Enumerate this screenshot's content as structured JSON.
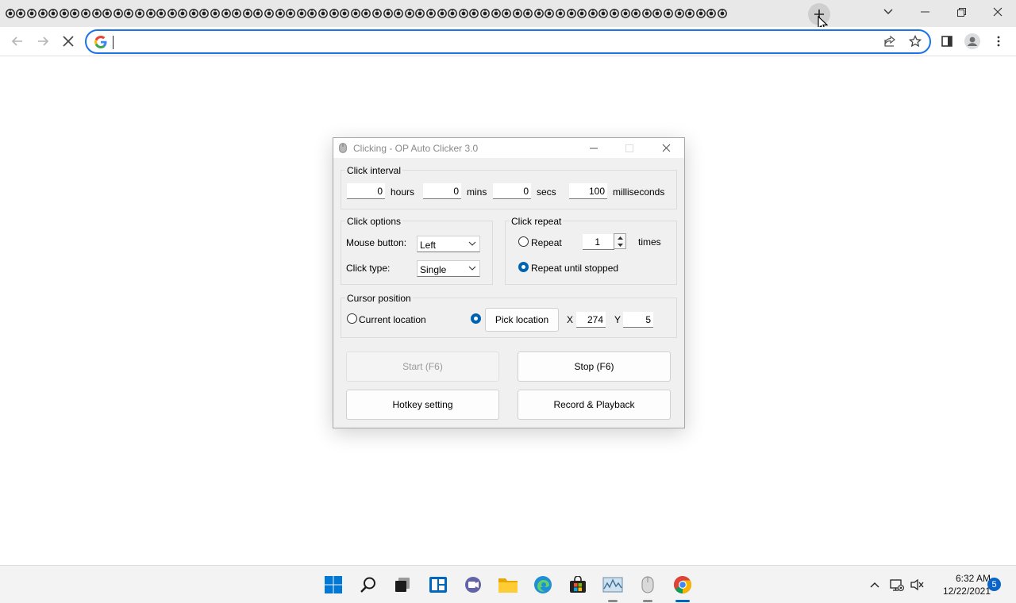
{
  "browser": {
    "tab_count": 67,
    "omnibox": {
      "value": "",
      "placeholder": ""
    }
  },
  "dialog": {
    "title": "Clicking - OP Auto Clicker 3.0",
    "click_interval": {
      "title": "Click interval",
      "hours": {
        "value": "0",
        "unit": "hours"
      },
      "mins": {
        "value": "0",
        "unit": "mins"
      },
      "secs": {
        "value": "0",
        "unit": "secs"
      },
      "ms": {
        "value": "100",
        "unit": "milliseconds"
      }
    },
    "click_options": {
      "title": "Click options",
      "mouse_button_label": "Mouse button:",
      "mouse_button_value": "Left",
      "click_type_label": "Click type:",
      "click_type_value": "Single"
    },
    "click_repeat": {
      "title": "Click repeat",
      "repeat_label": "Repeat",
      "repeat_value": "1",
      "times_label": "times",
      "until_stopped_label": "Repeat until stopped",
      "selected": "until_stopped"
    },
    "cursor_position": {
      "title": "Cursor position",
      "current_location_label": "Current location",
      "pick_location_label": "Pick location",
      "x_label": "X",
      "x_value": "274",
      "y_label": "Y",
      "y_value": "5",
      "selected": "pick_location"
    },
    "buttons": {
      "start": "Start (F6)",
      "stop": "Stop (F6)",
      "hotkey": "Hotkey setting",
      "record": "Record & Playback"
    }
  },
  "taskbar": {
    "apps": [
      "start-icon",
      "search-icon",
      "task-view-icon",
      "widgets-icon",
      "chat-icon",
      "file-explorer-icon",
      "edge-icon",
      "store-icon",
      "resource-monitor-icon",
      "auto-clicker-icon",
      "chrome-icon"
    ],
    "time": "6:32 AM",
    "date": "12/22/2021",
    "notifications": "5"
  },
  "colors": {
    "accent": "#1a73e8",
    "radio_selected": "#0063b1",
    "taskbar": "#f3f3f3"
  }
}
